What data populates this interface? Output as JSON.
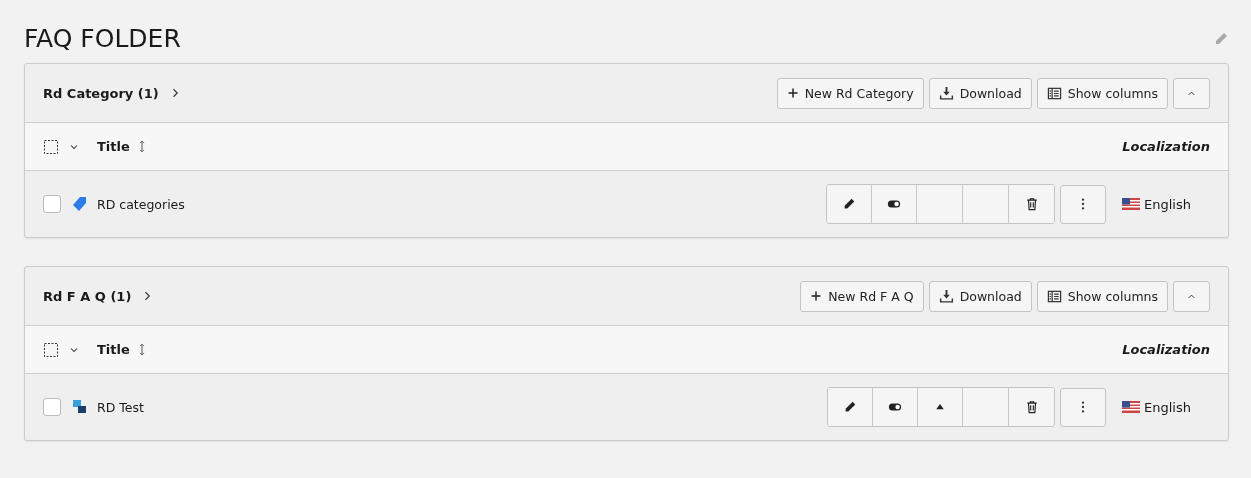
{
  "page": {
    "title": "FAQ FOLDER"
  },
  "panels": [
    {
      "title": "Rd Category (1)",
      "new_button": "New Rd Category",
      "download_button": "Download",
      "columns_button": "Show columns",
      "expanded": true,
      "columns": {
        "title": "Title",
        "localization": "Localization"
      },
      "rows": [
        {
          "title": "RD categories",
          "kind": "category",
          "checked": false,
          "actions": [
            {
              "kind": "edit"
            },
            {
              "kind": "toggle"
            },
            {
              "kind": "blank"
            },
            {
              "kind": "blank"
            },
            {
              "kind": "delete"
            }
          ],
          "language": "English"
        }
      ]
    },
    {
      "title": "Rd F A Q (1)",
      "new_button": "New Rd F A Q",
      "download_button": "Download",
      "columns_button": "Show columns",
      "expanded": true,
      "columns": {
        "title": "Title",
        "localization": "Localization"
      },
      "rows": [
        {
          "title": "RD Test",
          "kind": "faq",
          "checked": false,
          "actions": [
            {
              "kind": "edit"
            },
            {
              "kind": "toggle"
            },
            {
              "kind": "up"
            },
            {
              "kind": "blank"
            },
            {
              "kind": "delete"
            }
          ],
          "language": "English"
        }
      ]
    }
  ]
}
